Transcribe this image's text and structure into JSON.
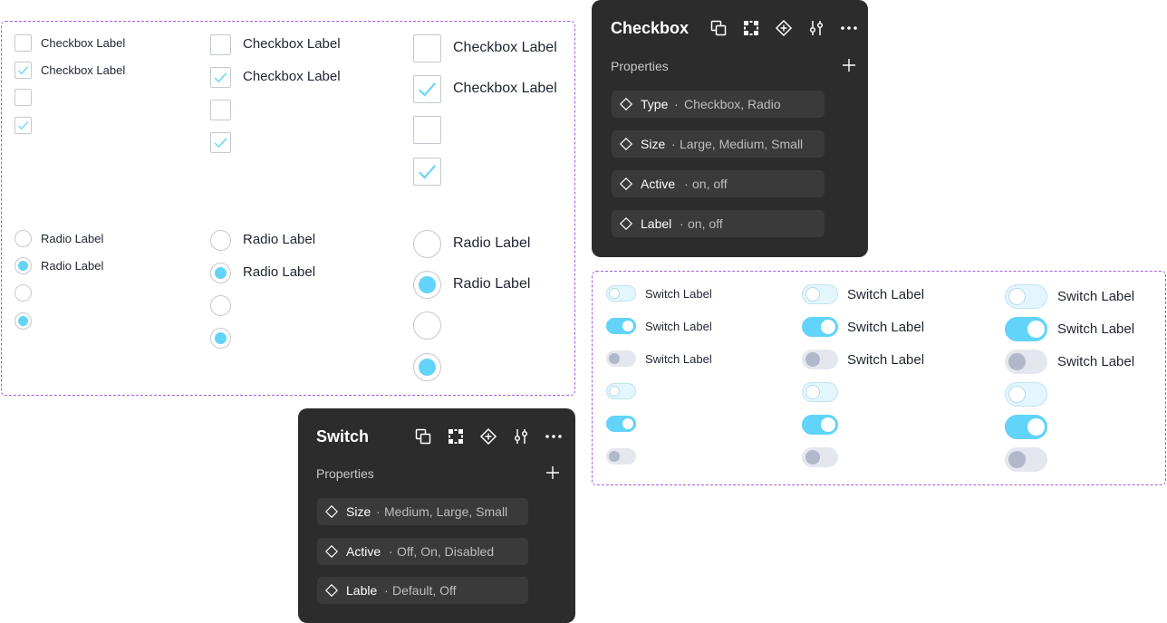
{
  "checkbox_labels": [
    "Checkbox Label",
    "Checkbox Label",
    "Checkbox Label",
    "Checkbox Label",
    "Checkbox Label",
    "Checkbox Label"
  ],
  "radio_labels": [
    "Radio Label",
    "Radio Label",
    "Radio Label",
    "Radio Label",
    "Radio Label",
    "Radio Label"
  ],
  "switch_labels": [
    "Switch Label",
    "Switch Label",
    "Switch Label",
    "Switch Label",
    "Switch Label",
    "Switch Label",
    "Switch Label",
    "Switch Label",
    "Switch Label"
  ],
  "checkbox_panel": {
    "title": "Checkbox",
    "section": "Properties",
    "properties": [
      {
        "name": "Type",
        "values": "Checkbox, Radio"
      },
      {
        "name": "Size",
        "values": "Large, Medium, Small"
      },
      {
        "name": "Active",
        "values": "on, off"
      },
      {
        "name": "Label",
        "values": "on, off"
      }
    ]
  },
  "switch_panel": {
    "title": "Switch",
    "section": "Properties",
    "properties": [
      {
        "name": "Size",
        "values": "Medium, Large, Small"
      },
      {
        "name": "Active",
        "values": "Off, On, Disabled"
      },
      {
        "name": "Lable",
        "values": "Default, Off"
      }
    ]
  },
  "separator": "·",
  "icons": [
    "component-instance-icon",
    "grid-dots-icon",
    "diamond-plus-icon",
    "sliders-icon",
    "more-icon",
    "plus-icon",
    "diamond-icon"
  ],
  "colors": {
    "accent": "#62d3f9",
    "frame_border": "#a35ce0",
    "panel_bg": "#2c2c2c",
    "prop_bg": "#3a3a3a",
    "disabled": "#b1b8c9"
  }
}
